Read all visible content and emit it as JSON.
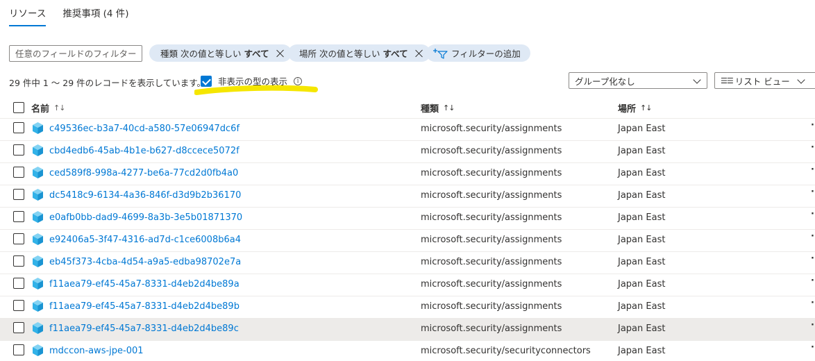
{
  "tabs": [
    {
      "label": "リソース",
      "active": true
    },
    {
      "label": "推奨事項 (4 件)",
      "active": false
    }
  ],
  "filter": {
    "placeholder": "任意のフィールドのフィルター...",
    "pills": [
      {
        "key": "種類",
        "op": "次の値と等しい",
        "value": "すべて"
      },
      {
        "key": "場所",
        "op": "次の値と等しい",
        "value": "すべて"
      }
    ],
    "add_label": "フィルターの追加"
  },
  "records_text": "29 件中 1 ～ 29 件のレコードを表示しています。",
  "show_hidden": {
    "label": "非表示の型の表示",
    "checked": true
  },
  "grouping": {
    "value": "グループ化なし"
  },
  "view": {
    "value": "リスト ビュー"
  },
  "columns": {
    "name": "名前",
    "type": "種類",
    "location": "場所"
  },
  "rows": [
    {
      "name": "c49536ec-b3a7-40cd-a580-57e06947dc6f",
      "type": "microsoft.security/assignments",
      "location": "Japan East"
    },
    {
      "name": "cbd4edb6-45ab-4b1e-b627-d8ccece5072f",
      "type": "microsoft.security/assignments",
      "location": "Japan East"
    },
    {
      "name": "ced589f8-998a-4277-be6a-77cd2d0fb4a0",
      "type": "microsoft.security/assignments",
      "location": "Japan East"
    },
    {
      "name": "dc5418c9-6134-4a36-846f-d3d9b2b36170",
      "type": "microsoft.security/assignments",
      "location": "Japan East"
    },
    {
      "name": "e0afb0bb-dad9-4699-8a3b-3e5b01871370",
      "type": "microsoft.security/assignments",
      "location": "Japan East"
    },
    {
      "name": "e92406a5-3f47-4316-ad7d-c1ce6008b6a4",
      "type": "microsoft.security/assignments",
      "location": "Japan East"
    },
    {
      "name": "eb45f373-4cba-4d54-a9a5-edba98702e7a",
      "type": "microsoft.security/assignments",
      "location": "Japan East"
    },
    {
      "name": "f11aea79-ef45-45a7-8331-d4eb2d4be89a",
      "type": "microsoft.security/assignments",
      "location": "Japan East"
    },
    {
      "name": "f11aea79-ef45-45a7-8331-d4eb2d4be89b",
      "type": "microsoft.security/assignments",
      "location": "Japan East"
    },
    {
      "name": "f11aea79-ef45-45a7-8331-d4eb2d4be89c",
      "type": "microsoft.security/assignments",
      "location": "Japan East",
      "hover": true
    },
    {
      "name": "mdccon-aws-jpe-001",
      "type": "microsoft.security/securityconnectors",
      "location": "Japan East"
    }
  ],
  "colors": {
    "accent": "#0078d4",
    "pill_bg": "#dfe9f5",
    "highlight": "#f5e600"
  }
}
